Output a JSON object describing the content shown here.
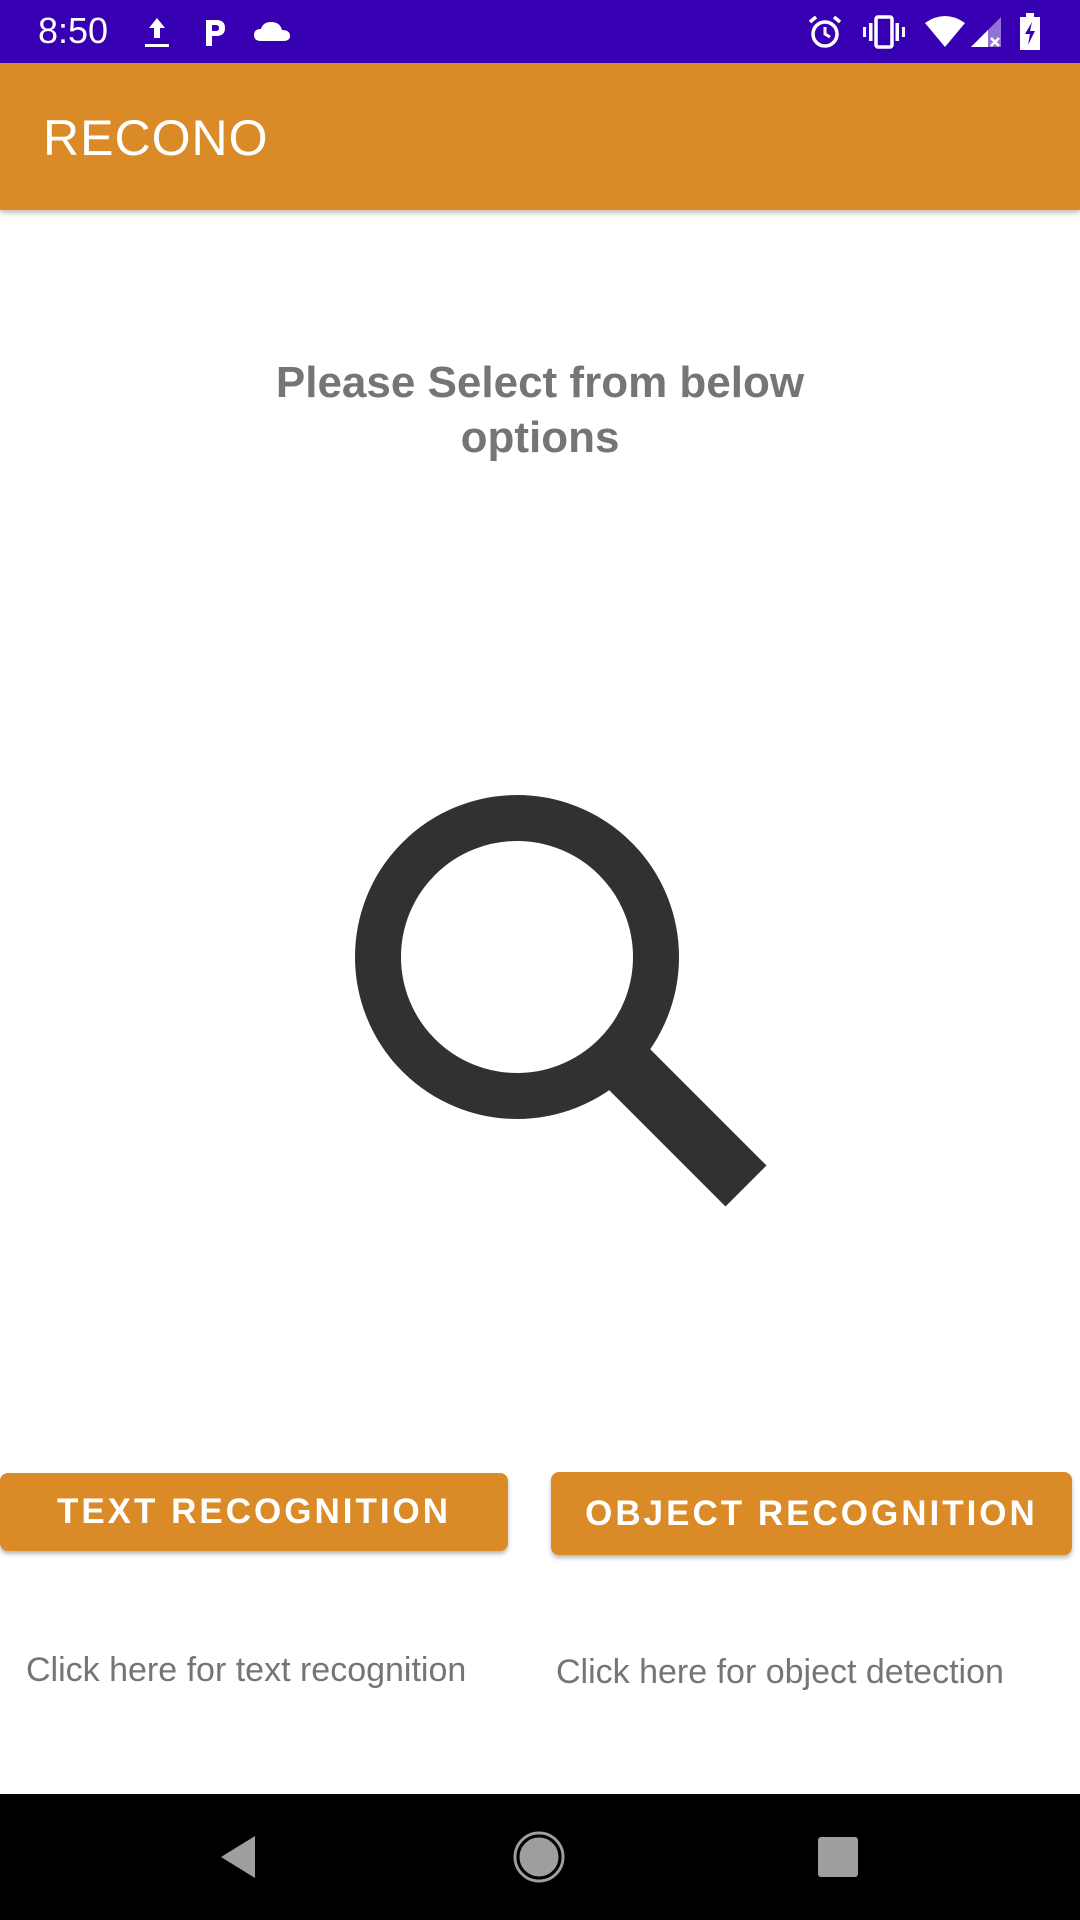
{
  "status_bar": {
    "time": "8:50",
    "icons_left": [
      "upload-icon",
      "parking-icon",
      "cloud-icon"
    ],
    "icons_right": [
      "alarm-icon",
      "vibrate-icon",
      "wifi-icon",
      "signal-icon",
      "battery-charging-icon"
    ],
    "background": "#3700b3"
  },
  "app_bar": {
    "title": "RECONO",
    "background": "#da8b27"
  },
  "main": {
    "instruction": "Please Select from below options",
    "illustration_icon": "search-icon",
    "buttons": {
      "text_recognition": {
        "label": "TEXT RECOGNITION",
        "caption": "Click here for text recognition"
      },
      "object_recognition": {
        "label": "OBJECT RECOGNITION",
        "caption": "Click here for object detection"
      }
    }
  },
  "nav_bar": {
    "items": [
      "back-icon",
      "home-icon",
      "recents-icon"
    ]
  }
}
